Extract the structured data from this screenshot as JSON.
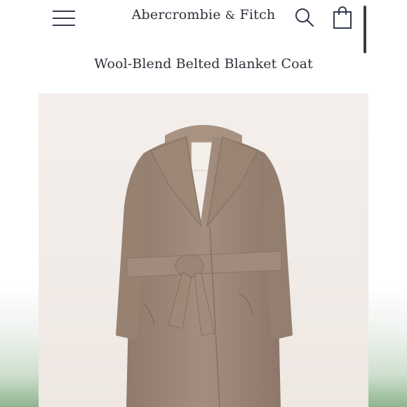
{
  "header": {
    "brand_name": "Abercrombie",
    "brand_amp": "&",
    "brand_fitch": "Fitch",
    "menu_icon": "hamburger-menu-icon",
    "search_icon": "search-icon",
    "bag_icon": "shopping-bag-icon"
  },
  "product": {
    "title": "Wool-Blend Belted Blanket Coat",
    "image_subject": "product-image-coat",
    "coat_color": "#a08b7c"
  },
  "colors": {
    "text": "#2b2f38",
    "image_background": "#f2ece8"
  }
}
